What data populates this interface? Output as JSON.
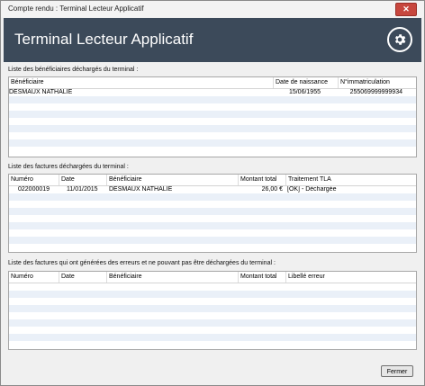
{
  "window": {
    "title": "Compte rendu : Terminal Lecteur Applicatif",
    "close_glyph": "✕"
  },
  "banner": {
    "title": "Terminal Lecteur Applicatif",
    "icon": "gear-icon"
  },
  "beneficiaires": {
    "label": "Liste des bénéficiaires déchargés du terminal :",
    "headers": [
      "Bénéficiaire",
      "Date de naissance",
      "N°immatriculation"
    ],
    "rows": [
      [
        "DESMAUX NATHALIE",
        "15/06/1955",
        "255069999999934"
      ]
    ]
  },
  "factures": {
    "label": "Liste des factures déchargées du terminal :",
    "headers": [
      "Numéro",
      "Date",
      "Bénéficiaire",
      "Montant total",
      "Traitement TLA"
    ],
    "rows": [
      [
        "022000019",
        "11/01/2015",
        "DESMAUX NATHALIE",
        "26,00 €",
        "[OK] - Déchargée"
      ]
    ]
  },
  "erreurs": {
    "label": "Liste des factures qui ont générées des erreurs et ne pouvant pas être déchargées du terminal :",
    "headers": [
      "Numéro",
      "Date",
      "Bénéficiaire",
      "Montant total",
      "Libellé erreur"
    ],
    "rows": []
  },
  "footer": {
    "close_label": "Fermer"
  },
  "colors": {
    "banner": "#3c4a5a",
    "row_alt": "#eaf0f8",
    "close_button": "#c7473e"
  }
}
